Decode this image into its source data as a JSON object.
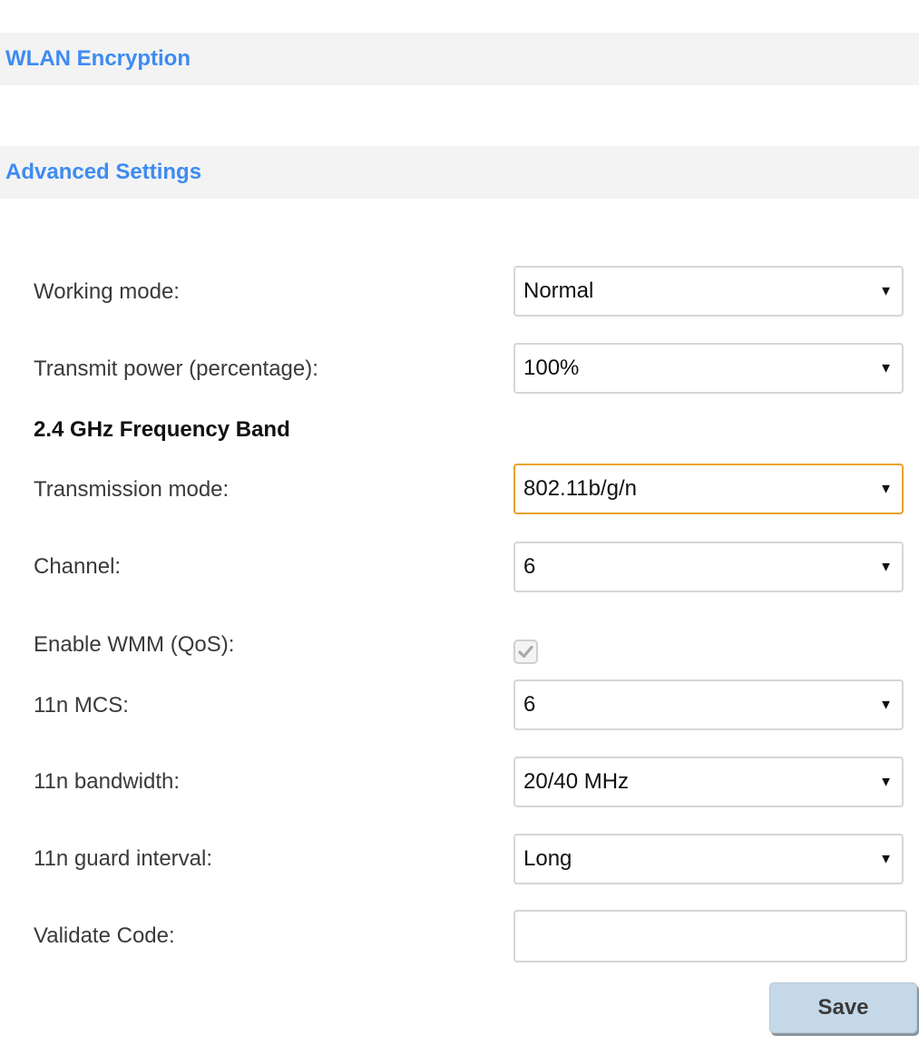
{
  "sections": {
    "wlan_encryption": "WLAN Encryption",
    "advanced_settings": "Advanced Settings"
  },
  "fields": {
    "working_mode": {
      "label": "Working mode:",
      "value": "Normal"
    },
    "transmit_power": {
      "label": "Transmit power (percentage):",
      "value": "100%"
    },
    "band_heading": "2.4 GHz Frequency Band",
    "transmission_mode": {
      "label": "Transmission mode:",
      "value": "802.11b/g/n"
    },
    "channel": {
      "label": "Channel:",
      "value": "6"
    },
    "wmm": {
      "label": "Enable WMM (QoS):",
      "checked": true
    },
    "mcs": {
      "label": "11n MCS:",
      "value": "6"
    },
    "bandwidth": {
      "label": "11n bandwidth:",
      "value": "20/40 MHz"
    },
    "guard_interval": {
      "label": "11n guard interval:",
      "value": "Long"
    },
    "validate_code": {
      "label": "Validate Code:",
      "value": "",
      "placeholder": ""
    }
  },
  "actions": {
    "save_label": "Save"
  },
  "icons": {
    "dropdown": "chevron-down-icon",
    "check": "check-icon"
  },
  "colors": {
    "section_title": "#3d8bf2",
    "section_bg": "#f3f3f3",
    "focus_border": "#e8a22c",
    "save_bg": "#c5d8e7"
  }
}
